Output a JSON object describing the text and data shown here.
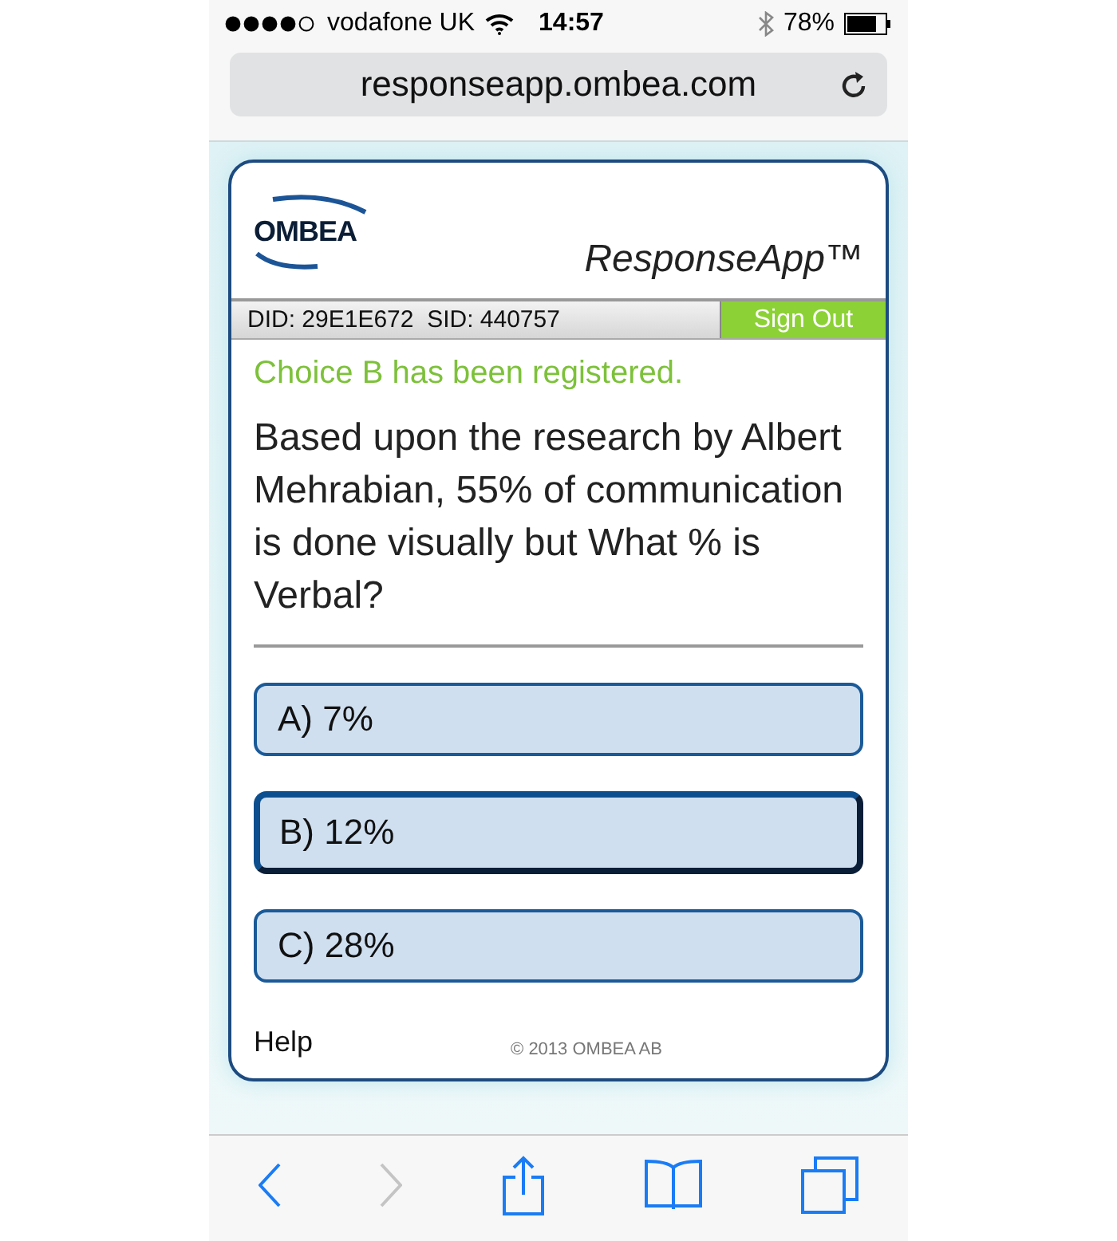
{
  "status_bar": {
    "carrier": "vodafone UK",
    "time": "14:57",
    "battery": "78%"
  },
  "address_bar": {
    "url": "responseapp.ombea.com"
  },
  "header": {
    "logo": "OMBEA",
    "app_title": "ResponseApp™"
  },
  "info_bar": {
    "ids": "DID: 29E1E672  SID: 440757",
    "sign_out": "Sign Out"
  },
  "message": "Choice B has been registered.",
  "question": "Based upon the research by Albert Mehrabian, 55% of communication is done visually but What % is Verbal?",
  "options": [
    {
      "label": "A) 7%",
      "selected": false
    },
    {
      "label": "B) 12%",
      "selected": true
    },
    {
      "label": "C) 28%",
      "selected": false
    }
  ],
  "footer": {
    "help": "Help",
    "copyright": "© 2013 OMBEA AB"
  },
  "toolbar": {
    "back_disabled": false,
    "forward_disabled": true
  }
}
